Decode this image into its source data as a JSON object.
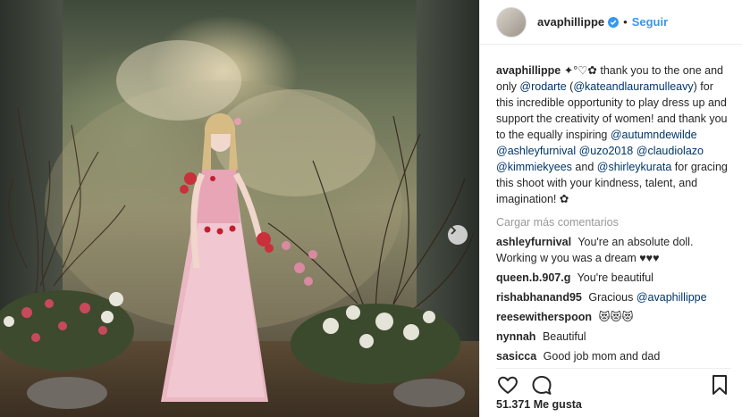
{
  "header": {
    "username": "avaphillippe",
    "separator": "•",
    "follow_label": "Seguir"
  },
  "caption": {
    "username": "avaphillippe",
    "emoji": "✦°♡✿",
    "text_1": " thank you to the one and only ",
    "mention_1": "@rodarte",
    "text_2": " (",
    "mention_2": "@kateandlauramulleavy",
    "text_3": ") for this incredible opportunity to play dress up and support the creativity of women! and thank you to the equally inspiring ",
    "mention_3": "@autumndewilde",
    "text_4": " ",
    "mention_4": "@ashleyfurnival",
    "text_5": " ",
    "mention_5": "@uzo2018",
    "text_6": " ",
    "mention_6": "@claudiolazo",
    "text_7": " ",
    "mention_7": "@kimmiekyees",
    "text_8": " and ",
    "mention_8": "@shirleykurata",
    "text_9": " for gracing this shoot with your kindness, talent, and imagination! ",
    "emoji_end": "✿"
  },
  "load_more_label": "Cargar más comentarios",
  "comments": [
    {
      "user": "ashleyfurnival",
      "text": "You're an absolute doll. Working w you was a dream ♥♥♥"
    },
    {
      "user": "queen.b.907.g",
      "text": "You're beautiful"
    },
    {
      "user": "rishabhanand95",
      "text": "Gracious ",
      "mention": "@avaphillippe"
    },
    {
      "user": "reesewitherspoon",
      "text": "😻😻😻"
    },
    {
      "user": "nynnah",
      "text": "Beautiful"
    },
    {
      "user": "sasicca",
      "text": "Good job mom and dad"
    }
  ],
  "likes_label": "51.371 Me gusta",
  "icons": {
    "verified": "verified-badge-icon",
    "like": "heart-icon",
    "comment": "comment-bubble-icon",
    "save": "bookmark-icon",
    "next": "chevron-right-icon"
  },
  "colors": {
    "link": "#003569",
    "follow": "#3897f0",
    "muted": "#999999"
  }
}
